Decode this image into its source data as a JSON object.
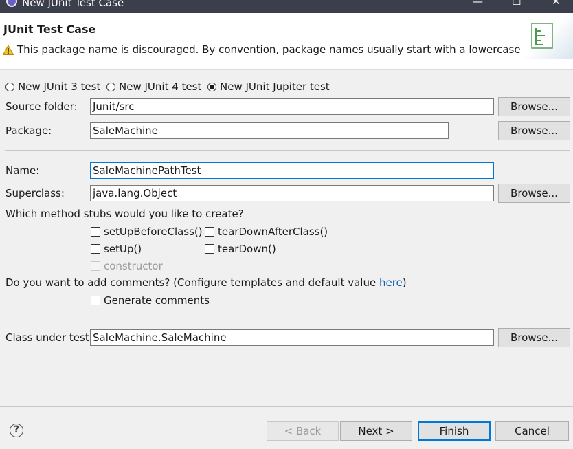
{
  "window": {
    "title": "New JUnit Test Case",
    "minimize_glyph": "—",
    "maximize_glyph": "☐",
    "close_glyph": "✕"
  },
  "header": {
    "heading": "JUnit Test Case",
    "warning_icon": "warning-icon",
    "warning_text": "This package name is discouraged. By convention, package names usually start with a lowercase letter"
  },
  "test_version": {
    "options": [
      {
        "label": "New JUnit 3 test",
        "checked": false
      },
      {
        "label": "New JUnit 4 test",
        "checked": false
      },
      {
        "label": "New JUnit Jupiter test",
        "checked": true
      }
    ]
  },
  "form": {
    "source_folder_label": "Source folder:",
    "source_folder_value": "Junit/src",
    "package_label": "Package:",
    "package_value": "SaleMachine",
    "name_label": "Name:",
    "name_value": "SaleMachinePathTest",
    "superclass_label": "Superclass:",
    "superclass_value": "java.lang.Object",
    "browse_label": "Browse...",
    "stubs_question": "Which method stubs would you like to create?",
    "stubs": {
      "setUpBeforeClass": "setUpBeforeClass()",
      "tearDownAfterClass": "tearDownAfterClass()",
      "setUp": "setUp()",
      "tearDown": "tearDown()",
      "constructor": "constructor"
    },
    "comments_question_prefix": "Do you want to add comments? (Configure templates and default value ",
    "comments_link": "here",
    "comments_question_suffix": ")",
    "generate_comments": "Generate comments",
    "class_under_test_label": "Class under test:",
    "class_under_test_value": "SaleMachine.SaleMachine"
  },
  "footer": {
    "help_glyph": "?",
    "back": "< Back",
    "next": "Next >",
    "finish": "Finish",
    "cancel": "Cancel"
  }
}
